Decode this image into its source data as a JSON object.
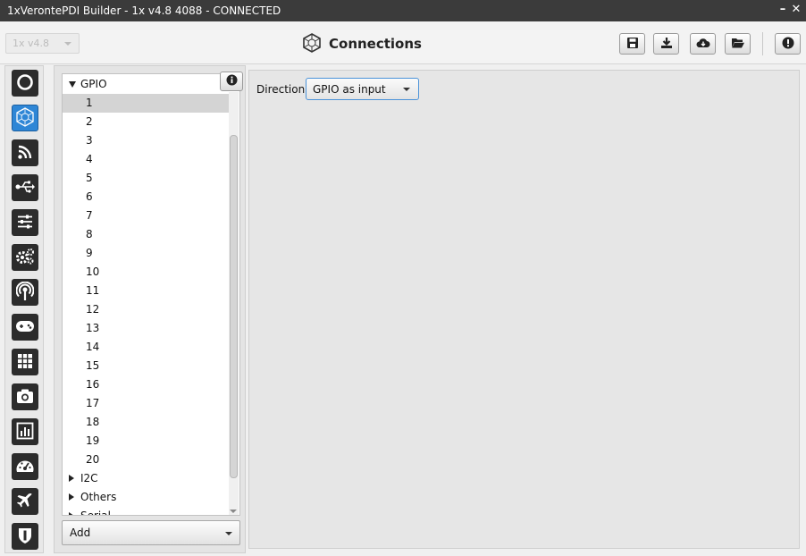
{
  "window": {
    "title": "1xVerontePDI Builder - 1x v4.8 4088 - CONNECTED",
    "minimize_glyph": "–",
    "close_glyph": "✕"
  },
  "header": {
    "version_selector": "1x v4.8",
    "page_title": "Connections",
    "page_icon": "connections-hex-icon",
    "buttons": [
      "save-icon",
      "download-icon",
      "cloud-download-icon",
      "folder-open-icon",
      "info-icon"
    ]
  },
  "sidebar": {
    "items": [
      {
        "icon": "power-ring-icon"
      },
      {
        "icon": "connections-hex-icon",
        "active": true
      },
      {
        "icon": "rss-feed-icon"
      },
      {
        "icon": "usb-icon"
      },
      {
        "icon": "sliders-icon"
      },
      {
        "icon": "gears-icon"
      },
      {
        "icon": "broadcast-icon"
      },
      {
        "icon": "gamepad-icon"
      },
      {
        "icon": "grid-icon"
      },
      {
        "icon": "camera-icon"
      },
      {
        "icon": "bar-chart-icon"
      },
      {
        "icon": "dashboard-gauge-icon"
      },
      {
        "icon": "airplane-icon"
      },
      {
        "icon": "shield-icon"
      }
    ]
  },
  "tree": {
    "groups": [
      {
        "label": "GPIO",
        "expanded": true
      },
      {
        "label": "I2C",
        "expanded": false
      },
      {
        "label": "Others",
        "expanded": false
      },
      {
        "label": "Serial",
        "expanded": false
      }
    ],
    "gpio_items": [
      "1",
      "2",
      "3",
      "4",
      "5",
      "6",
      "7",
      "8",
      "9",
      "10",
      "11",
      "12",
      "13",
      "14",
      "15",
      "16",
      "17",
      "18",
      "19",
      "20"
    ],
    "selected": "1"
  },
  "left_panel": {
    "add_label": "Add"
  },
  "main": {
    "direction_label": "Direction",
    "direction_value": "GPIO as input"
  },
  "colors": {
    "titlebar": "#3b3b3b",
    "sidebar_button": "#2c2c2c",
    "active_accent": "#2e86d6",
    "select_border": "#4b93d9"
  }
}
